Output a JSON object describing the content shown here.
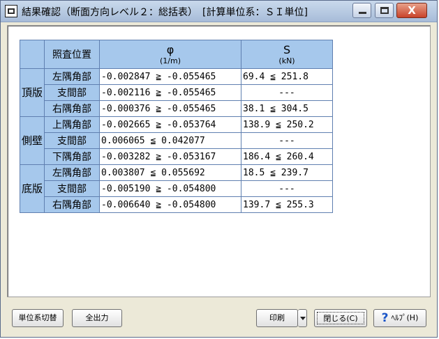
{
  "window": {
    "title": "結果確認（断面方向レベル２：総括表）　[計算単位系：ＳＩ単位]",
    "close_glyph": "X"
  },
  "table": {
    "header": {
      "position": "照査位置",
      "phi_symbol": "φ",
      "phi_unit": "(1/m)",
      "s_symbol": "S",
      "s_unit": "(kN)"
    },
    "groups": [
      {
        "label": "頂版",
        "rows": [
          {
            "location": "左隅角部",
            "phi": "-0.002847 ≧ -0.055465",
            "s": "69.4 ≦ 251.8"
          },
          {
            "location": "支間部",
            "phi": "-0.002116 ≧ -0.055465",
            "s": "---"
          },
          {
            "location": "右隅角部",
            "phi": "-0.000376 ≧ -0.055465",
            "s": "38.1 ≦ 304.5"
          }
        ]
      },
      {
        "label": "側壁",
        "rows": [
          {
            "location": "上隅角部",
            "phi": "-0.002665 ≧ -0.053764",
            "s": "138.9 ≦ 250.2"
          },
          {
            "location": "支間部",
            "phi": " 0.006065 ≦ 0.042077",
            "s": "---"
          },
          {
            "location": "下隅角部",
            "phi": "-0.003282 ≧ -0.053167",
            "s": "186.4 ≦ 260.4"
          }
        ]
      },
      {
        "label": "底版",
        "rows": [
          {
            "location": "左隅角部",
            "phi": " 0.003807 ≦ 0.055692",
            "s": " 18.5 ≦ 239.7"
          },
          {
            "location": "支間部",
            "phi": "-0.005190 ≧ -0.054800",
            "s": "---"
          },
          {
            "location": "右隅角部",
            "phi": "-0.006640 ≧ -0.054800",
            "s": "139.7 ≦ 255.3"
          }
        ]
      }
    ]
  },
  "buttons": {
    "unit_switch": "単位系切替",
    "output_all": "全出力",
    "print": "印刷",
    "close": "閉じる(C)",
    "help": "ﾍﾙﾌﾟ(H)"
  }
}
